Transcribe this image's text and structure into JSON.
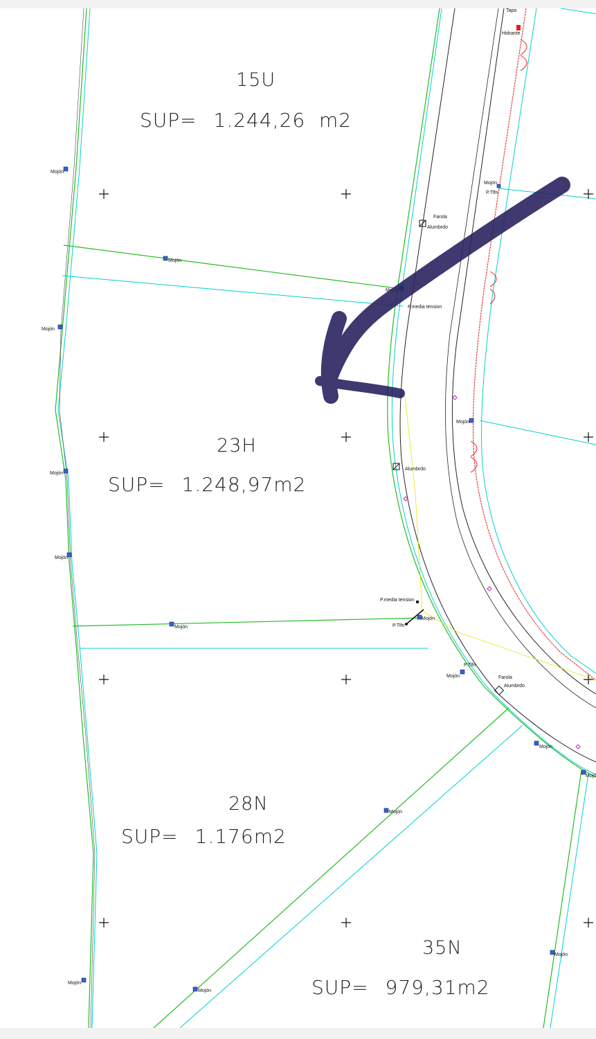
{
  "parcels": [
    {
      "id": "15U",
      "sup_label": "SUP=",
      "sup_value": "1.244,26  m2"
    },
    {
      "id": "23H",
      "sup_label": "SUP=",
      "sup_value": "1.248,97m2"
    },
    {
      "id": "28N",
      "sup_label": "SUP=",
      "sup_value": "1.176m2"
    },
    {
      "id": "35N",
      "sup_label": "SUP=",
      "sup_value": "979,31m2"
    }
  ],
  "annotations": {
    "mojon": "Mojón",
    "p_tlfn": "P.Tlfn",
    "farola": "Farola",
    "alumbrdo": "Alumbrdo",
    "alumbrado": "Alumbrdo",
    "p_media_tension": "P.media tension",
    "hidrante": "Hidrante",
    "tapa": "Tapa"
  },
  "colors": {
    "parcel_line": "#22bb22",
    "offset_line": "#00d0d0",
    "road_line": "#222222",
    "hydrant_line": "#e02020",
    "utility_line": "#e6e600",
    "marker": "#3a5fd0",
    "arrow": "#2a2460"
  }
}
